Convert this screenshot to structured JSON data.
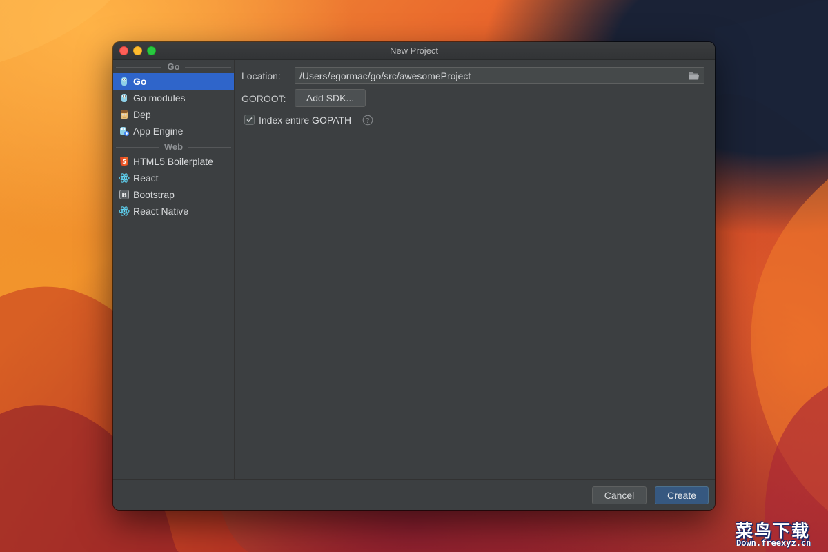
{
  "window": {
    "title": "New Project",
    "controls": [
      "close",
      "minimize",
      "maximize"
    ]
  },
  "sidebar": {
    "groups": [
      {
        "header": "Go",
        "items": [
          {
            "label": "Go",
            "icon": "gopher-icon",
            "selected": true
          },
          {
            "label": "Go modules",
            "icon": "gopher-icon"
          },
          {
            "label": "Dep",
            "icon": "dep-icon"
          },
          {
            "label": "App Engine",
            "icon": "app-engine-icon"
          }
        ]
      },
      {
        "header": "Web",
        "items": [
          {
            "label": "HTML5 Boilerplate",
            "icon": "html5-icon"
          },
          {
            "label": "React",
            "icon": "react-icon"
          },
          {
            "label": "Bootstrap",
            "icon": "bootstrap-icon"
          },
          {
            "label": "React Native",
            "icon": "react-icon"
          }
        ]
      }
    ]
  },
  "form": {
    "location_label": "Location:",
    "location_value": "/Users/egormac/go/src/awesomeProject",
    "goroot_label": "GOROOT:",
    "add_sdk_label": "Add SDK...",
    "index_gopath_label": "Index entire GOPATH",
    "index_gopath_checked": true
  },
  "footer": {
    "cancel_label": "Cancel",
    "create_label": "Create"
  },
  "watermark": {
    "title": "菜鸟下载",
    "url": "Down.freexyz.cn"
  },
  "colors": {
    "selection": "#2f65ca",
    "window_bg": "#3c3f41",
    "primary_button": "#365880"
  }
}
